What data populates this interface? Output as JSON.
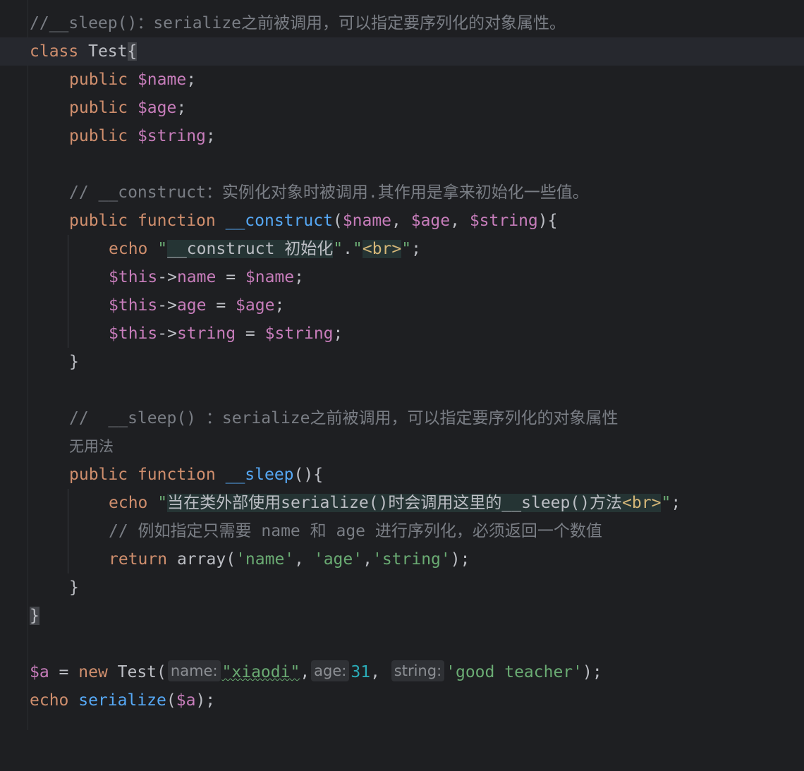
{
  "colors": {
    "background": "#1e1f22",
    "comment": "#7a7e85",
    "keyword": "#cf8e6d",
    "variable": "#c77dbb",
    "function": "#56a8f5",
    "string": "#6aab73",
    "number": "#2aacb8",
    "html_tag": "#d5b778",
    "text": "#bcbec4"
  },
  "code": {
    "l1": {
      "comment": "//__sleep()：serialize之前被调用，可以指定要序列化的对象属性。"
    },
    "l2": {
      "kw_class": "class",
      "class_name": " Test",
      "brace_open": "{"
    },
    "l3": {
      "kw": "public",
      "var": "$name",
      "end": ";"
    },
    "l4": {
      "kw": "public",
      "var": "$age",
      "end": ";"
    },
    "l5": {
      "kw": "public",
      "var": "$string",
      "end": ";"
    },
    "l7": {
      "comment": "// __construct：实例化对象时被调用.其作用是拿来初始化一些值。"
    },
    "l8": {
      "kw_public": "public",
      "kw_function": "function",
      "fn_name": "__construct",
      "paren_open": "(",
      "p1": "$name",
      "sep1": ", ",
      "p2": "$age",
      "sep2": ", ",
      "p3": "$string",
      "paren_close": "){"
    },
    "l9": {
      "kw_echo": "echo",
      "q1": "\"",
      "str_text": "__construct 初始化",
      "q2": "\"",
      "concat": ".",
      "q3": "\"",
      "tag_text": "<br>",
      "q4": "\"",
      "end": ";"
    },
    "l10": {
      "this": "$this",
      "arrow": "->",
      "prop": "name",
      "eq": " = ",
      "val": "$name",
      "end": ";"
    },
    "l11": {
      "this": "$this",
      "arrow": "->",
      "prop": "age",
      "eq": " = ",
      "val": "$age",
      "end": ";"
    },
    "l12": {
      "this": "$this",
      "arrow": "->",
      "prop": "string",
      "eq": " = ",
      "val": "$string",
      "end": ";"
    },
    "l13": {
      "brace_close": "}"
    },
    "l15": {
      "comment": "//  __sleep() ：serialize之前被调用，可以指定要序列化的对象属性"
    },
    "l16": {
      "note": "无用法"
    },
    "l17": {
      "kw_public": "public",
      "kw_function": "function",
      "fn_name": "__sleep",
      "paren": "(){"
    },
    "l18": {
      "kw_echo": "echo",
      "q1": "\"",
      "str_text": "当在类外部使用serialize()时会调用这里的__sleep()方法",
      "tag_text": "<br>",
      "q2": "\"",
      "end": ";"
    },
    "l19": {
      "comment": "// 例如指定只需要 name 和 age 进行序列化，必须返回一个数值"
    },
    "l20": {
      "kw_return": "return",
      "fn_array": "array",
      "paren_open": "(",
      "s1": "'name'",
      "sep1": ", ",
      "s2": "'age'",
      "sep2": ",",
      "s3": "'string'",
      "end": ");"
    },
    "l21": {
      "brace_close": "}"
    },
    "l22": {
      "brace_close": "}"
    },
    "l24": {
      "var_a": "$a",
      "eq": " = ",
      "kw_new": "new",
      "class_name": " Test(",
      "hint_name": "name:",
      "arg1": "\"xiaodi\"",
      "sep1": ",",
      "hint_age": "age:",
      "arg2": "31",
      "sep2": ", ",
      "hint_string": "string:",
      "arg3": "'good teacher'",
      "end": ");"
    },
    "l25": {
      "kw_echo": "echo",
      "fn_serialize": "serialize",
      "paren_open": "(",
      "arg": "$a",
      "end": ");"
    }
  }
}
